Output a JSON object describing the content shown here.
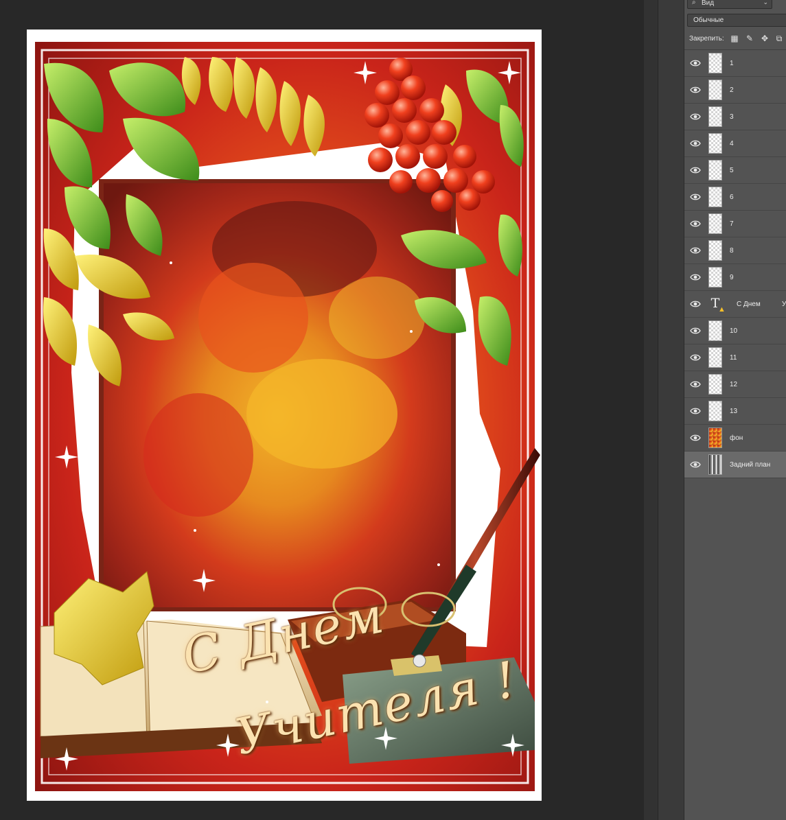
{
  "layers_panel": {
    "filter_kind": "Вид",
    "blend_mode": "Обычные",
    "lock_label": "Закрепить:",
    "layers": [
      {
        "name": "1",
        "thumb": "transparent"
      },
      {
        "name": "2",
        "thumb": "transparent"
      },
      {
        "name": "3",
        "thumb": "transparent"
      },
      {
        "name": "4",
        "thumb": "transparent"
      },
      {
        "name": "5",
        "thumb": "transparent"
      },
      {
        "name": "6",
        "thumb": "transparent"
      },
      {
        "name": "7",
        "thumb": "transparent"
      },
      {
        "name": "8",
        "thumb": "transparent"
      },
      {
        "name": "9",
        "thumb": "transparent"
      },
      {
        "name": "С Днем",
        "thumb": "text",
        "extra": "У"
      },
      {
        "name": "10",
        "thumb": "transparent"
      },
      {
        "name": "11",
        "thumb": "transparent"
      },
      {
        "name": "12",
        "thumb": "transparent"
      },
      {
        "name": "13",
        "thumb": "transparent"
      },
      {
        "name": "фон",
        "thumb": "image"
      },
      {
        "name": "Задний план",
        "thumb": "background",
        "active": true
      }
    ]
  },
  "document": {
    "greeting_line1": "С Днем",
    "greeting_line2": "Учителя !"
  },
  "icons": {
    "filter": "search-icon",
    "eye": "eye-icon",
    "locks": [
      "lock-transparent-icon",
      "lock-brush-icon",
      "lock-move-icon",
      "lock-artboard-icon"
    ]
  },
  "colors": {
    "canvas_bg": "#282828",
    "panel_bg": "#535353",
    "active_layer": "#6a6a6a"
  }
}
